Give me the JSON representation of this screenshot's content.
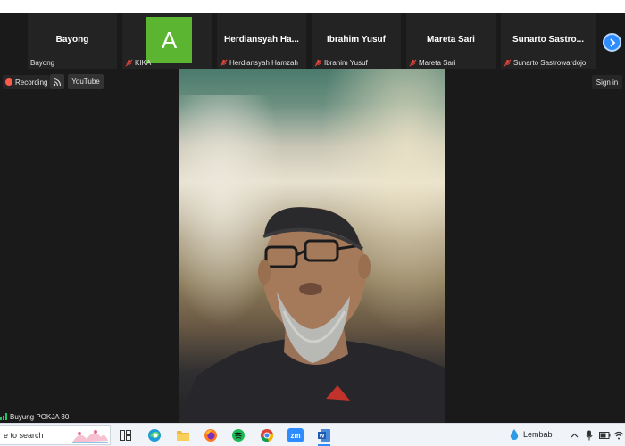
{
  "strip": {
    "participants": [
      {
        "display_name": "Bayong",
        "label": "Bayong",
        "muted": false
      },
      {
        "display_name": "",
        "avatar_letter": "A",
        "label": "KIKA",
        "muted": true
      },
      {
        "display_name": "Herdiansyah  Ha...",
        "label": "Herdiansyah Hamzah",
        "muted": true
      },
      {
        "display_name": "Ibrahim Yusuf",
        "label": "Ibrahim Yusuf",
        "muted": true
      },
      {
        "display_name": "Mareta Sari",
        "label": "Mareta Sari",
        "muted": true
      },
      {
        "display_name": "Sunarto  Sastro...",
        "label": "Sunarto Sastrowardojo",
        "muted": true
      }
    ],
    "next_icon": "chevron-right-icon"
  },
  "toolbar": {
    "recording_label": "Recording",
    "rss_icon": "rss-icon",
    "youtube_label": "YouTube",
    "signin_label": "Sign in"
  },
  "video": {
    "speaker_label": "Buyung POKJA 30"
  },
  "taskbar": {
    "search_placeholder": "e to search",
    "weather_label": "Lembab",
    "apps": [
      "task-view-icon",
      "edge-icon",
      "file-explorer-icon",
      "firefox-icon",
      "spotify-icon",
      "chrome-icon",
      "zoom-icon",
      "word-icon"
    ]
  },
  "colors": {
    "accent": "#2d8cff",
    "muted_red": "#e5463b",
    "avatar_green": "#5cb531"
  }
}
